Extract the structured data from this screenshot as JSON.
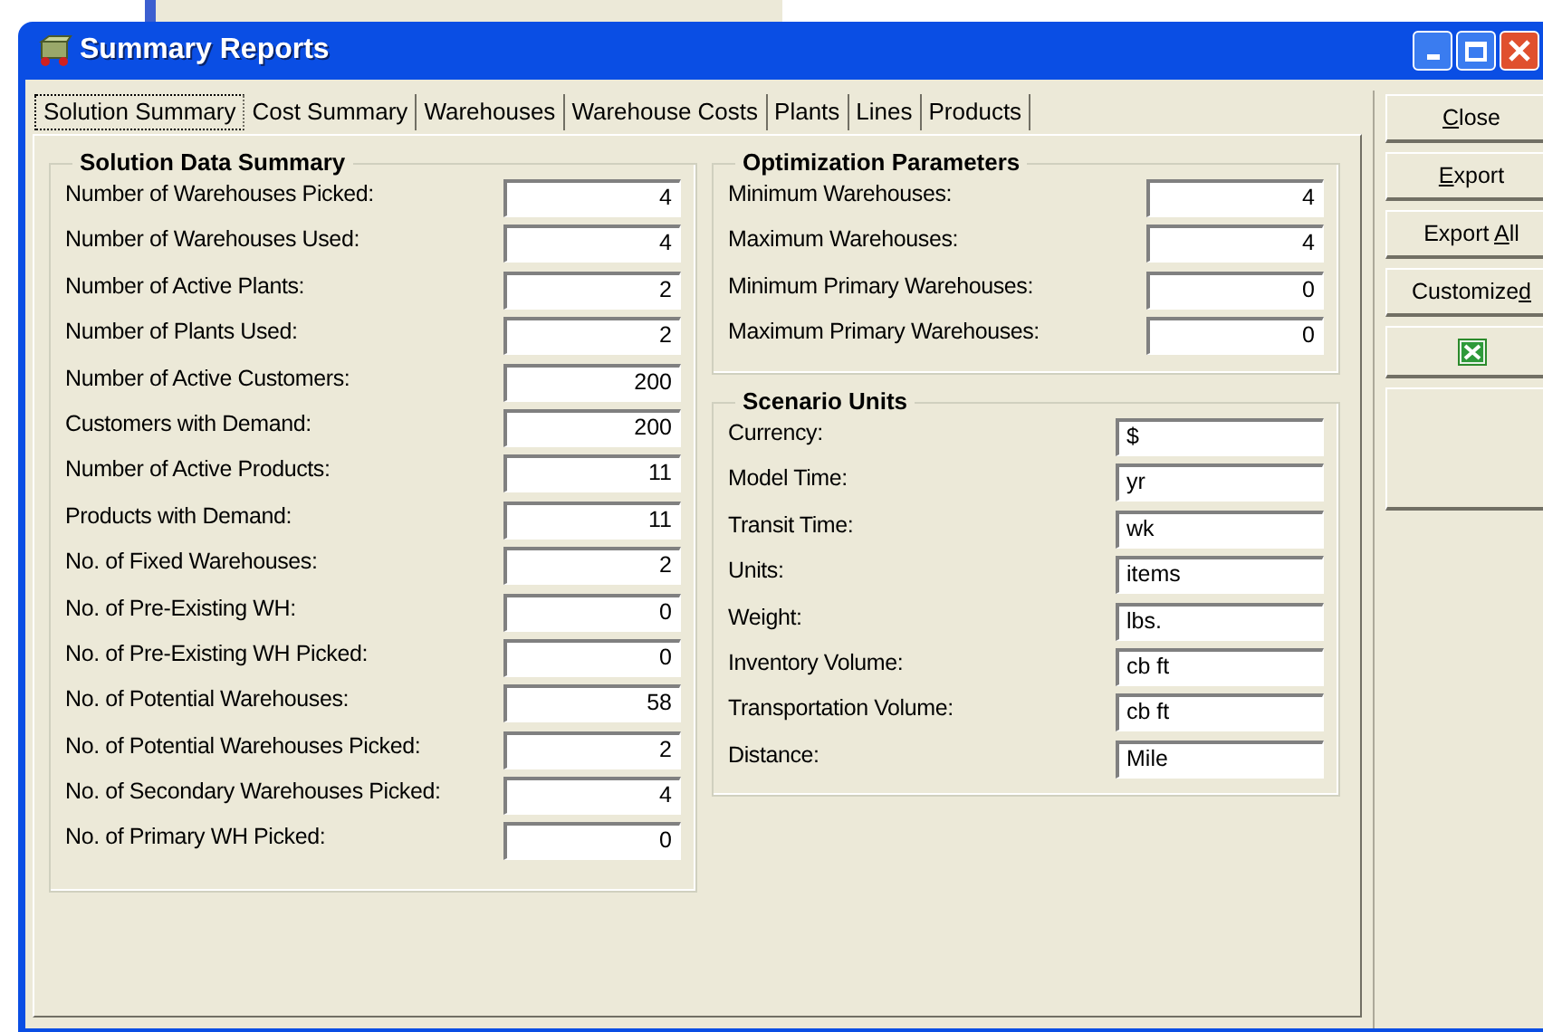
{
  "window": {
    "title": "Summary Reports"
  },
  "tabs": [
    {
      "label": "Solution Summary",
      "selected": true
    },
    {
      "label": "Cost Summary",
      "selected": false
    },
    {
      "label": "Warehouses",
      "selected": false
    },
    {
      "label": "Warehouse Costs",
      "selected": false
    },
    {
      "label": "Plants",
      "selected": false
    },
    {
      "label": "Lines",
      "selected": false
    },
    {
      "label": "Products",
      "selected": false
    }
  ],
  "solution_data_summary": {
    "title": "Solution Data Summary",
    "rows": [
      {
        "label": "Number of Warehouses Picked:",
        "value": "4"
      },
      {
        "label": "Number of Warehouses Used:",
        "value": "4"
      },
      {
        "label": "Number of Active Plants:",
        "value": "2"
      },
      {
        "label": "Number of Plants Used:",
        "value": "2"
      },
      {
        "label": "Number of Active Customers:",
        "value": "200"
      },
      {
        "label": "Customers with Demand:",
        "value": "200"
      },
      {
        "label": "Number of Active Products:",
        "value": "11"
      },
      {
        "label": "Products with Demand:",
        "value": "11"
      },
      {
        "label": "No. of Fixed Warehouses:",
        "value": "2"
      },
      {
        "label": "No. of Pre-Existing WH:",
        "value": "0"
      },
      {
        "label": "No. of Pre-Existing WH Picked:",
        "value": "0"
      },
      {
        "label": "No. of Potential Warehouses:",
        "value": "58"
      },
      {
        "label": "No. of Potential Warehouses Picked:",
        "value": "2"
      },
      {
        "label": "No. of Secondary Warehouses Picked:",
        "value": "4"
      },
      {
        "label": "No. of Primary WH Picked:",
        "value": "0"
      }
    ]
  },
  "optimization_parameters": {
    "title": "Optimization Parameters",
    "rows": [
      {
        "label": "Minimum Warehouses:",
        "value": "4"
      },
      {
        "label": "Maximum Warehouses:",
        "value": "4"
      },
      {
        "label": "Minimum Primary Warehouses:",
        "value": "0"
      },
      {
        "label": "Maximum Primary Warehouses:",
        "value": "0"
      }
    ]
  },
  "scenario_units": {
    "title": "Scenario Units",
    "rows": [
      {
        "label": "Currency:",
        "value": "$"
      },
      {
        "label": "Model Time:",
        "value": "yr"
      },
      {
        "label": "Transit Time:",
        "value": "wk"
      },
      {
        "label": "Units:",
        "value": "items"
      },
      {
        "label": "Weight:",
        "value": "lbs."
      },
      {
        "label": "Inventory Volume:",
        "value": "cb ft"
      },
      {
        "label": "Transportation Volume:",
        "value": "cb ft"
      },
      {
        "label": "Distance:",
        "value": "Mile"
      }
    ]
  },
  "buttons": [
    {
      "kind": "text",
      "access_key": "C",
      "after": "lose"
    },
    {
      "kind": "text",
      "access_key": "E",
      "after": "xport"
    },
    {
      "kind": "text",
      "before": "Export ",
      "access_key": "A",
      "after": "ll"
    },
    {
      "kind": "text",
      "before": "Customize",
      "access_key": "d"
    },
    {
      "kind": "excel"
    },
    {
      "kind": "blank"
    }
  ]
}
